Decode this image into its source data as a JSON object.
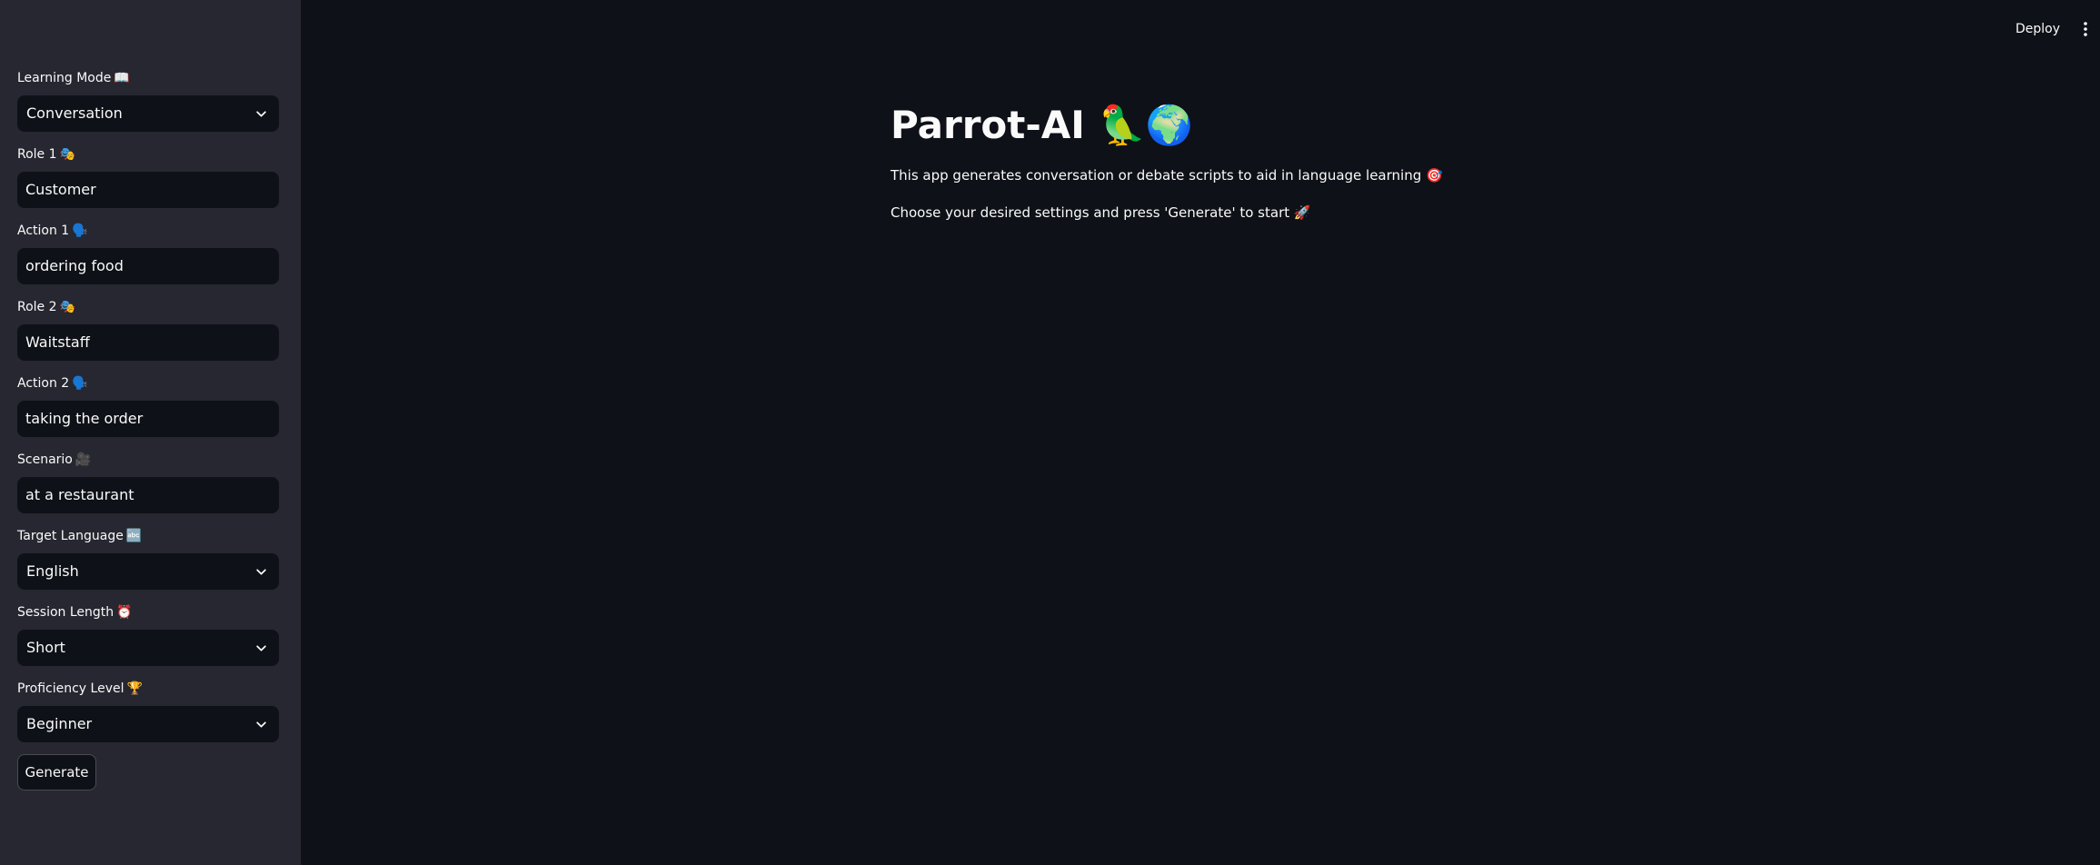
{
  "sidebar": {
    "learning_mode": {
      "label": "Learning Mode",
      "emoji": "📖",
      "value": "Conversation"
    },
    "role1": {
      "label": "Role 1",
      "emoji": "🎭",
      "value": "Customer"
    },
    "action1": {
      "label": "Action 1",
      "emoji": "🗣️",
      "value": "ordering food"
    },
    "role2": {
      "label": "Role 2",
      "emoji": "🎭",
      "value": "Waitstaff"
    },
    "action2": {
      "label": "Action 2",
      "emoji": "🗣️",
      "value": "taking the order"
    },
    "scenario": {
      "label": "Scenario",
      "emoji": "🎥",
      "value": "at a restaurant"
    },
    "target_language": {
      "label": "Target Language",
      "emoji": "🔤",
      "value": "English"
    },
    "session_length": {
      "label": "Session Length",
      "emoji": "⏰",
      "value": "Short"
    },
    "proficiency_level": {
      "label": "Proficiency Level",
      "emoji": "🏆",
      "value": "Beginner"
    },
    "generate_label": "Generate"
  },
  "header": {
    "deploy_label": "Deploy",
    "menu_icon": "vertical-ellipsis-icon"
  },
  "main": {
    "title": "Parrot-AI 🦜🌍",
    "description": "This app generates conversation or debate scripts to aid in language learning 🎯",
    "instruction": "Choose your desired settings and press 'Generate' to start 🚀"
  },
  "colors": {
    "sidebar_bg": "#262730",
    "main_bg": "#0e1117",
    "input_bg": "#0e1117",
    "text": "#fafafa"
  }
}
